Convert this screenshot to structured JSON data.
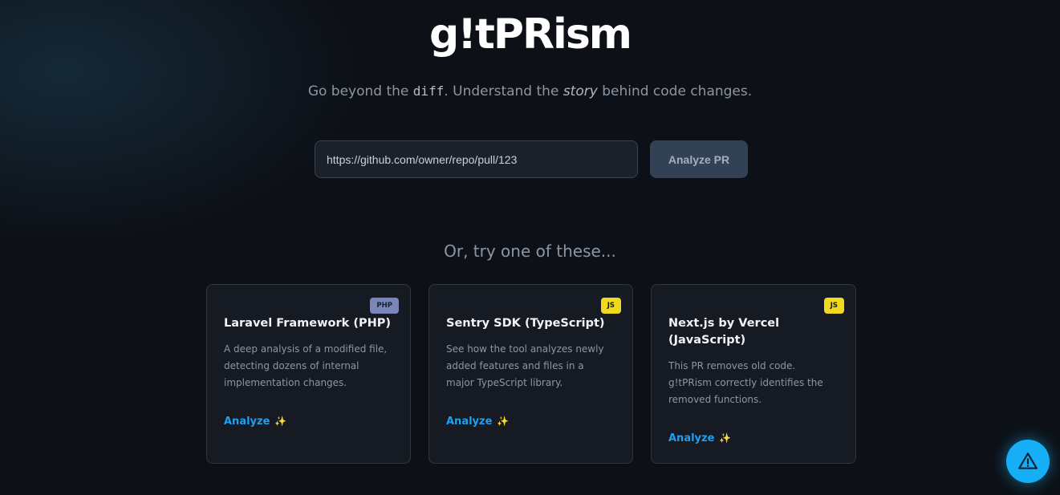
{
  "app": {
    "title": "g!tPRism"
  },
  "tagline": {
    "prefix": "Go beyond the ",
    "code": "diff",
    "middle": ". Understand the ",
    "emphasis": "story",
    "suffix": " behind code changes."
  },
  "search": {
    "value": "https://github.com/owner/repo/pull/123",
    "button_label": "Analyze PR"
  },
  "examples": {
    "heading": "Or, try one of these...",
    "cards": [
      {
        "title": "Laravel Framework (PHP)",
        "badge": "PHP",
        "description": "A deep analysis of a modified file, detecting dozens of internal implementation changes.",
        "link_label": "Analyze",
        "link_icon": "✨"
      },
      {
        "title": "Sentry SDK (TypeScript)",
        "badge": "JS",
        "description": "See how the tool analyzes newly added features and files in a major TypeScript library.",
        "link_label": "Analyze",
        "link_icon": "✨"
      },
      {
        "title": "Next.js by Vercel (JavaScript)",
        "badge": "JS",
        "description": "This PR removes old code. g!tPRism correctly identifies the removed functions.",
        "link_label": "Analyze",
        "link_icon": "✨"
      }
    ]
  },
  "fab": {
    "icon": "warning-triangle-icon"
  },
  "colors": {
    "background": "#0d1117",
    "card_background": "#161b23",
    "accent_link": "#1f9ff0",
    "fab": "#16aef5",
    "php_badge": "#7a86b8",
    "js_badge": "#f1d91c"
  }
}
